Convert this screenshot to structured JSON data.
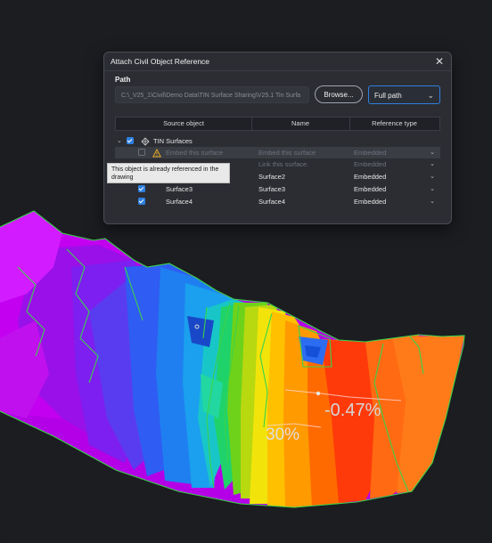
{
  "dialog": {
    "title": "Attach Civil Object Reference",
    "path_label": "Path",
    "path_value": "C:\\_V25_1\\Civil\\Demo Data\\TIN  Surface Sharing\\V25.1 Tin Surfa",
    "browse_label": "Browse...",
    "path_mode": "Full path",
    "columns": [
      "Source object",
      "Name",
      "Reference type"
    ],
    "tree_root": "TIN Surfaces",
    "rows": [
      {
        "source": "Embed this surface",
        "name": "Embed this surface",
        "type": "Embedded"
      },
      {
        "source": "",
        "name": "Link this surface.",
        "type": "Embedded"
      },
      {
        "source": "",
        "name": "Surface2",
        "type": "Embedded"
      },
      {
        "source": "Surface3",
        "name": "Surface3",
        "type": "Embedded"
      },
      {
        "source": "Surface4",
        "name": "Surface4",
        "type": "Embedded"
      }
    ],
    "tooltip": "This object is already referenced in the drawing"
  },
  "terrain": {
    "slope_label_1": "-0.47%",
    "slope_label_2": "30%"
  },
  "colors": {
    "accent": "#2f7fe0",
    "dialog_bg": "#2b2d33",
    "canvas_bg": "#1b1d21"
  }
}
